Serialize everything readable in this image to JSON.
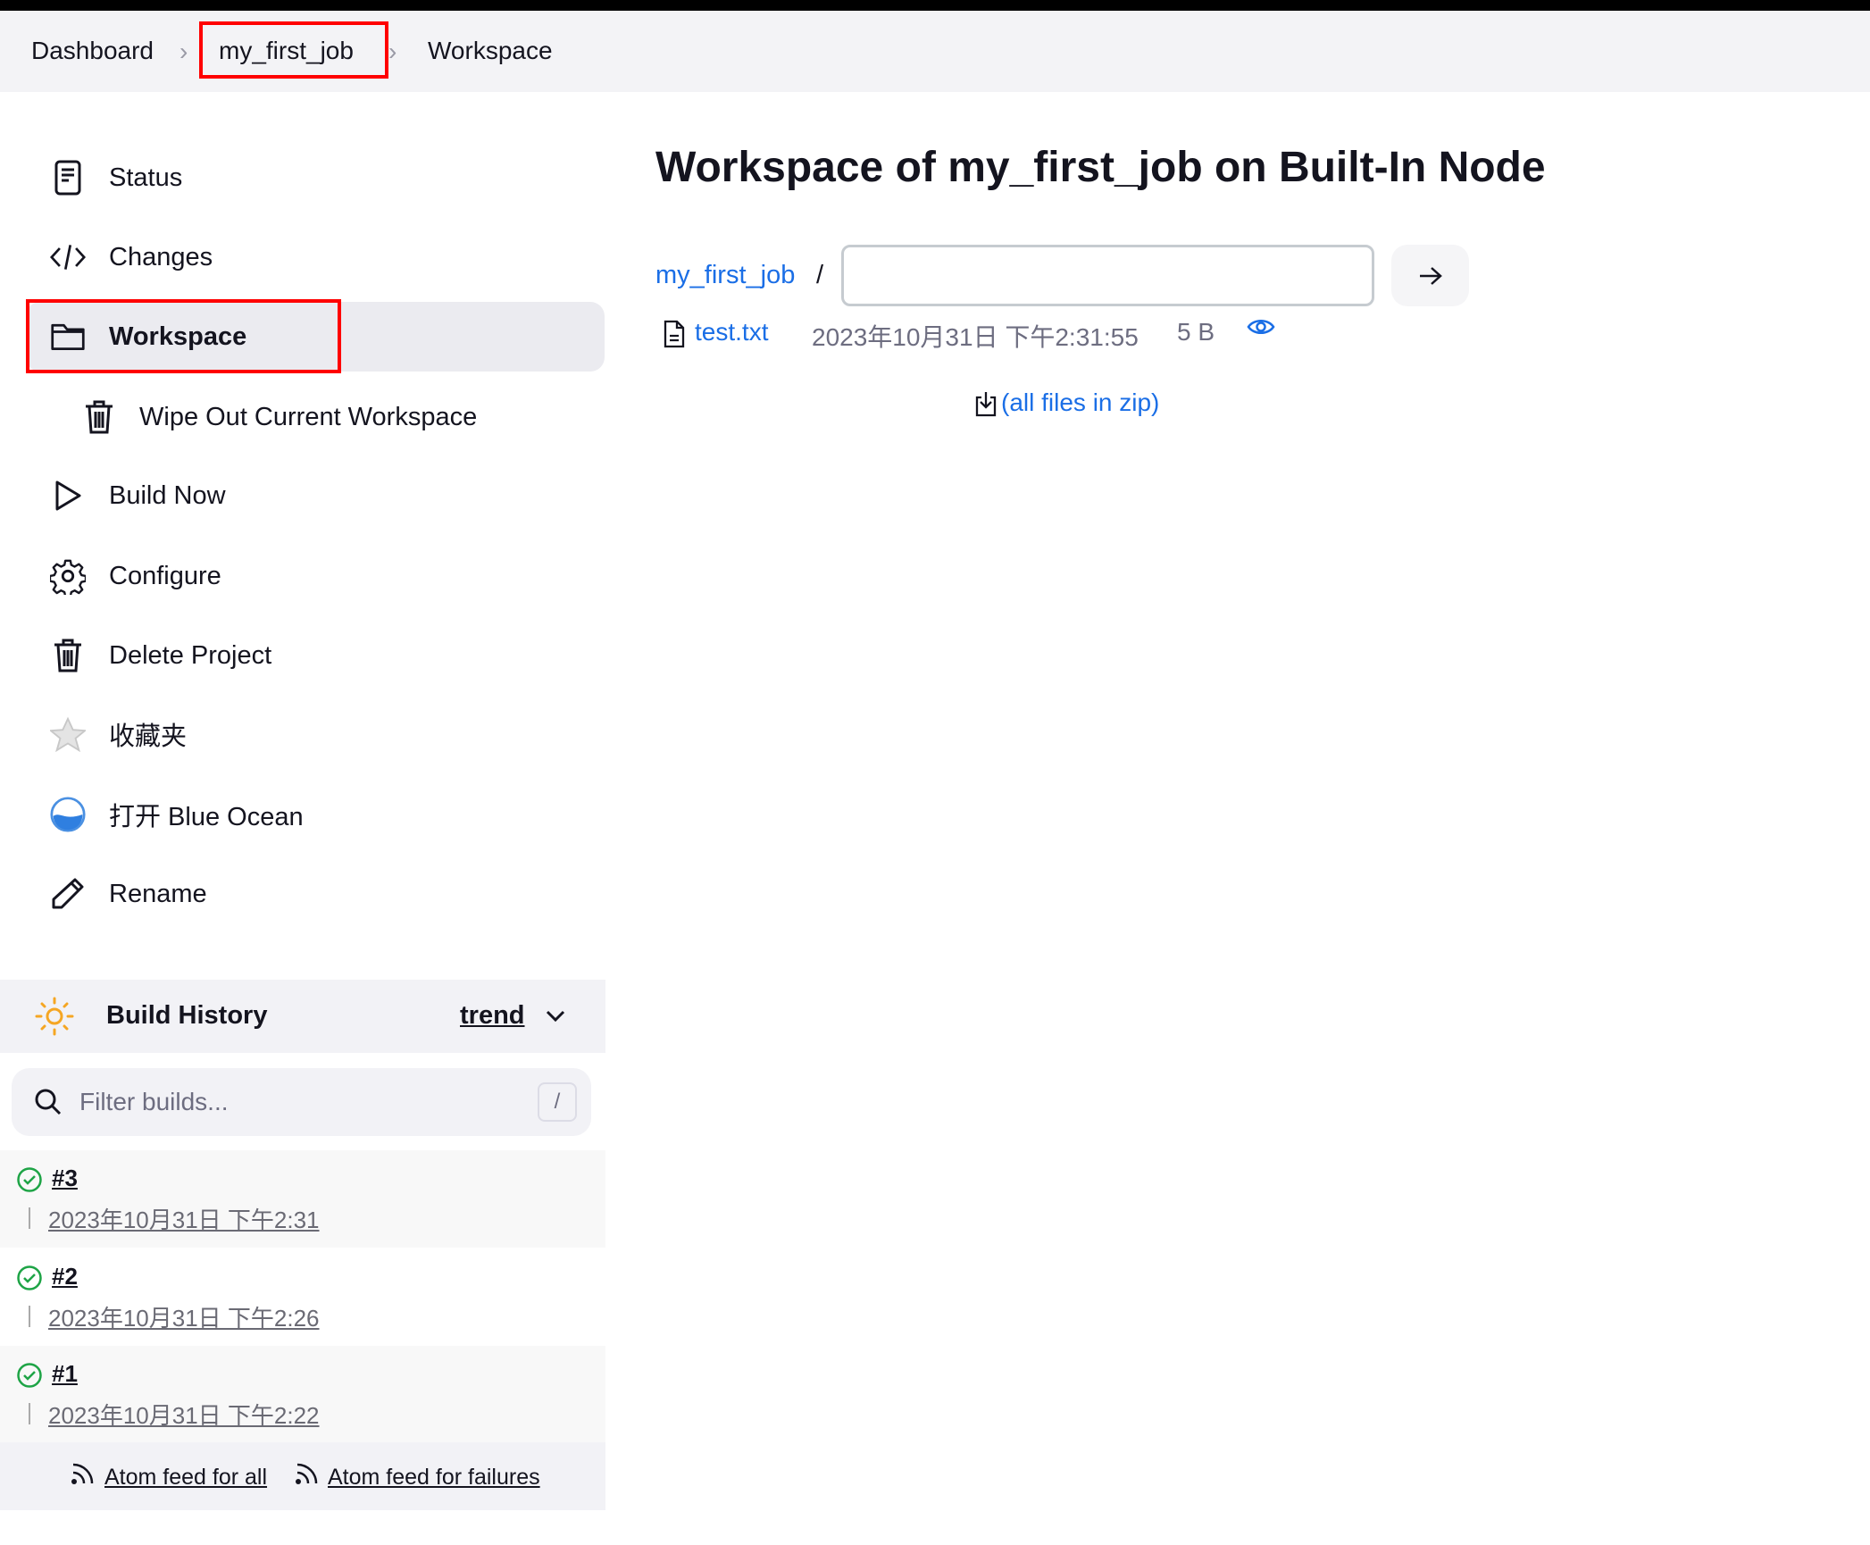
{
  "breadcrumb": {
    "items": [
      "Dashboard",
      "my_first_job",
      "Workspace"
    ]
  },
  "sidebar": {
    "items": [
      {
        "label": "Status",
        "icon": "status-icon"
      },
      {
        "label": "Changes",
        "icon": "code-icon"
      },
      {
        "label": "Workspace",
        "icon": "folder-icon"
      },
      {
        "label": "Wipe Out Current Workspace",
        "icon": "trash-icon"
      },
      {
        "label": "Build Now",
        "icon": "play-icon"
      },
      {
        "label": "Configure",
        "icon": "gear-icon"
      },
      {
        "label": "Delete Project",
        "icon": "trash-icon"
      },
      {
        "label": "收藏夹",
        "icon": "star-icon"
      },
      {
        "label": "打开 Blue Ocean",
        "icon": "blue-ocean-icon"
      },
      {
        "label": "Rename",
        "icon": "pencil-icon"
      }
    ]
  },
  "main": {
    "title": "Workspace of my_first_job on Built-In Node",
    "path_root": "my_first_job",
    "path_sep": "/",
    "path_input": "",
    "files": [
      {
        "name": "test.txt",
        "modified": "2023年10月31日 下午2:31:55",
        "size": "5 B"
      }
    ],
    "zip_label": "(all files in zip)"
  },
  "build_history": {
    "title": "Build History",
    "trend": "trend",
    "filter_placeholder": "Filter builds...",
    "shortcut": "/",
    "builds": [
      {
        "number": "#3",
        "date": "2023年10月31日 下午2:31",
        "status": "success"
      },
      {
        "number": "#2",
        "date": "2023年10月31日 下午2:26",
        "status": "success"
      },
      {
        "number": "#1",
        "date": "2023年10月31日 下午2:22",
        "status": "success"
      }
    ],
    "feed_all": "Atom feed for all",
    "feed_failures": "Atom feed for failures"
  },
  "colors": {
    "link": "#1a6ee6",
    "success": "#1ea446",
    "highlight": "#ff0000",
    "sun": "#f5a623"
  }
}
